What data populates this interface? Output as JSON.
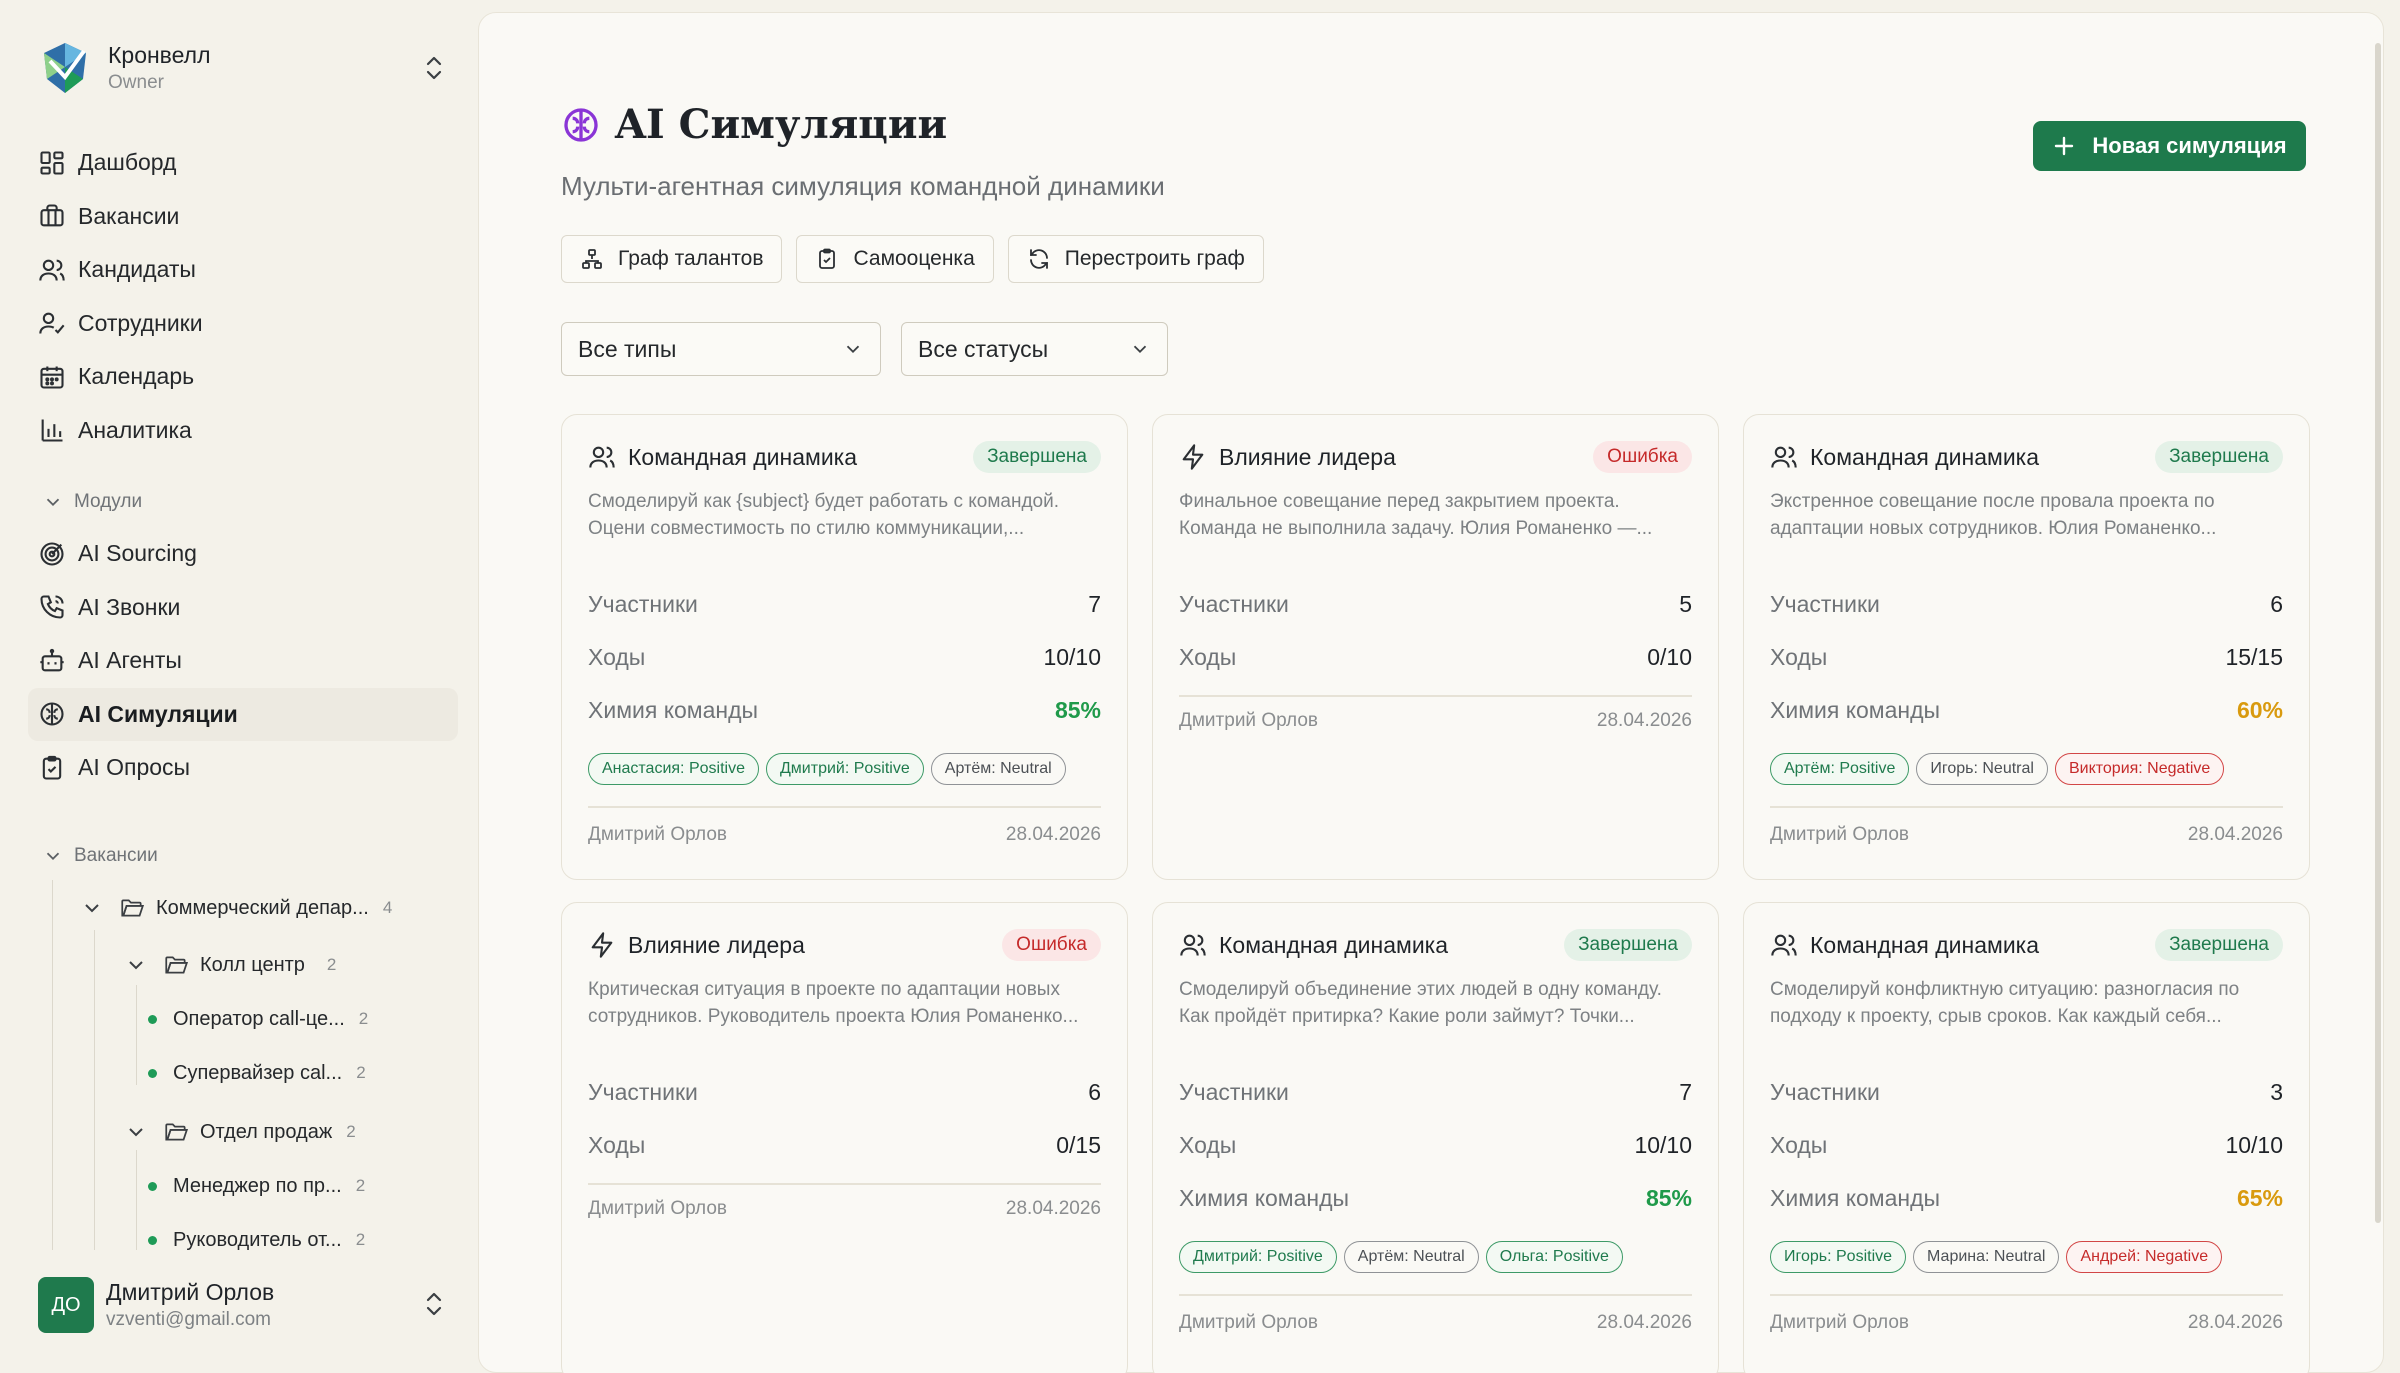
{
  "org": {
    "name": "Кронвелл",
    "role": "Owner"
  },
  "nav": [
    {
      "label": "Дашборд",
      "icon": "dashboard-icon"
    },
    {
      "label": "Вакансии",
      "icon": "briefcase-icon"
    },
    {
      "label": "Кандидаты",
      "icon": "users-icon"
    },
    {
      "label": "Сотрудники",
      "icon": "user-check-icon"
    },
    {
      "label": "Календарь",
      "icon": "calendar-icon"
    },
    {
      "label": "Аналитика",
      "icon": "bar-chart-icon"
    }
  ],
  "modules": {
    "heading": "Модули",
    "items": [
      {
        "label": "AI Sourcing",
        "icon": "target-icon"
      },
      {
        "label": "AI Звонки",
        "icon": "phone-icon"
      },
      {
        "label": "AI Агенты",
        "icon": "bot-icon"
      },
      {
        "label": "AI Симуляции",
        "icon": "brain-icon",
        "active": true
      },
      {
        "label": "AI Опросы",
        "icon": "clipboard-icon"
      }
    ]
  },
  "vacancies_tree": {
    "heading": "Вакансии",
    "items": [
      {
        "label": "Коммерческий депар...",
        "count": "4"
      },
      {
        "label": "Колл центр",
        "count": "2"
      },
      {
        "label": "Оператор call-це...",
        "count": "2"
      },
      {
        "label": "Супервайзер cal...",
        "count": "2"
      },
      {
        "label": "Отдел продаж",
        "count": "2"
      },
      {
        "label": "Менеджер по пр...",
        "count": "2"
      },
      {
        "label": "Руководитель от...",
        "count": "2"
      }
    ]
  },
  "user": {
    "initials": "ДО",
    "name": "Дмитрий Орлов",
    "email": "vzventi@gmail.com"
  },
  "page": {
    "title": "AI Симуляции",
    "subtitle": "Мульти-агентная симуляция командной динамики",
    "new_button": "Новая симуляция",
    "tools": [
      "Граф талантов",
      "Самооценка",
      "Перестроить граф"
    ],
    "filters": {
      "type": "Все типы",
      "status": "Все статусы"
    }
  },
  "labels": {
    "participants": "Участники",
    "moves": "Ходы",
    "chemistry": "Химия команды"
  },
  "accent_colors": {
    "primary": "#1e7a4c",
    "positive": "#1f9a4a",
    "warning": "#d99a0e",
    "negative": "#c52a2a"
  },
  "cards": [
    {
      "icon": "users-icon",
      "title": "Командная динамика",
      "status": "Завершена",
      "status_kind": "ok",
      "desc1": "Смоделируй как {subject} будет работать с командой.",
      "desc2": "Оцени совместимость по стилю коммуникации,...",
      "participants": "7",
      "moves": "10/10",
      "chemistry": "85%",
      "chem_kind": "green",
      "tags": [
        {
          "text": "Анастасия: Positive",
          "kind": "positive"
        },
        {
          "text": "Дмитрий: Positive",
          "kind": "positive"
        },
        {
          "text": "Артём: Neutral",
          "kind": "neutral"
        }
      ],
      "author": "Дмитрий Орлов",
      "date": "28.04.2026"
    },
    {
      "icon": "lightning-icon",
      "title": "Влияние лидера",
      "status": "Ошибка",
      "status_kind": "err",
      "desc1": "Финальное совещание перед закрытием проекта.",
      "desc2": "Команда не выполнила задачу. Юлия Романенко —...",
      "participants": "5",
      "moves": "0/10",
      "chemistry": null,
      "chem_kind": null,
      "tags": [],
      "author": "Дмитрий Орлов",
      "date": "28.04.2026"
    },
    {
      "icon": "users-icon",
      "title": "Командная динамика",
      "status": "Завершена",
      "status_kind": "ok",
      "desc1": "Экстренное совещание после провала проекта по",
      "desc2": "адаптации новых сотрудников. Юлия Романенко...",
      "participants": "6",
      "moves": "15/15",
      "chemistry": "60%",
      "chem_kind": "amber",
      "tags": [
        {
          "text": "Артём: Positive",
          "kind": "positive"
        },
        {
          "text": "Игорь: Neutral",
          "kind": "neutral"
        },
        {
          "text": "Виктория: Negative",
          "kind": "negative"
        }
      ],
      "author": "Дмитрий Орлов",
      "date": "28.04.2026"
    },
    {
      "icon": "lightning-icon",
      "title": "Влияние лидера",
      "status": "Ошибка",
      "status_kind": "err",
      "desc1": "Критическая ситуация в проекте по адаптации новых",
      "desc2": "сотрудников. Руководитель проекта Юлия Романенко...",
      "participants": "6",
      "moves": "0/15",
      "chemistry": null,
      "chem_kind": null,
      "tags": [],
      "author": "Дмитрий Орлов",
      "date": "28.04.2026"
    },
    {
      "icon": "users-icon",
      "title": "Командная динамика",
      "status": "Завершена",
      "status_kind": "ok",
      "desc1": "Смоделируй объединение этих людей в одну команду.",
      "desc2": "Как пройдёт притирка? Какие роли займут? Точки...",
      "participants": "7",
      "moves": "10/10",
      "chemistry": "85%",
      "chem_kind": "green",
      "tags": [
        {
          "text": "Дмитрий: Positive",
          "kind": "positive"
        },
        {
          "text": "Артём: Neutral",
          "kind": "neutral"
        },
        {
          "text": "Ольга: Positive",
          "kind": "positive"
        }
      ],
      "author": "Дмитрий Орлов",
      "date": "28.04.2026"
    },
    {
      "icon": "users-icon",
      "title": "Командная динамика",
      "status": "Завершена",
      "status_kind": "ok",
      "desc1": "Смоделируй конфликтную ситуацию: разногласия по",
      "desc2": "подходу к проекту, срыв сроков. Как каждый себя...",
      "participants": "3",
      "moves": "10/10",
      "chemistry": "65%",
      "chem_kind": "amber",
      "tags": [
        {
          "text": "Игорь: Positive",
          "kind": "positive"
        },
        {
          "text": "Марина: Neutral",
          "kind": "neutral"
        },
        {
          "text": "Андрей: Negative",
          "kind": "negative"
        }
      ],
      "author": "Дмитрий Орлов",
      "date": "28.04.2026"
    }
  ]
}
